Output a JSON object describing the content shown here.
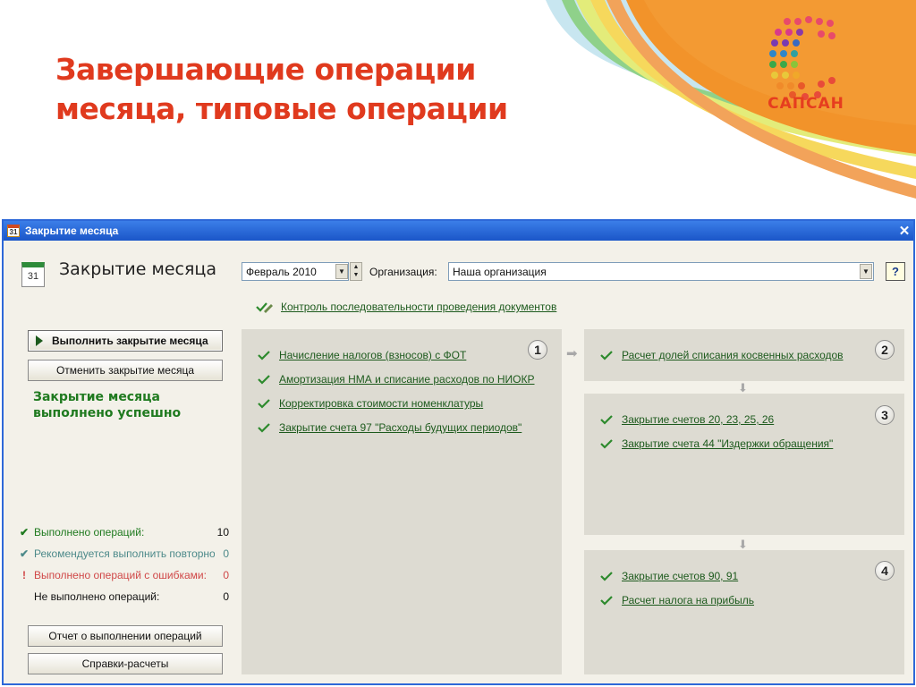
{
  "slide": {
    "title_line1": "Завершающие операции",
    "title_line2": "месяца, типовые операции",
    "logo_text": "САПСАН"
  },
  "window": {
    "title": "Закрытие месяца",
    "close_icon": "close-icon",
    "form_title": "Закрытие месяца",
    "period": "Февраль 2010",
    "org_label": "Организация:",
    "org_value": "Наша организация",
    "help_label": "?",
    "control_link": "Контроль последовательности проведения документов",
    "run_button": "Выполнить закрытие месяца",
    "cancel_button": "Отменить закрытие месяца",
    "status_line1": "Закрытие месяца",
    "status_line2": "выполнено успешно",
    "stats": [
      {
        "label": "Выполнено операций:",
        "value": "10",
        "color": "#1f7a1f",
        "icon": "✔"
      },
      {
        "label": "Рекомендуется выполнить повторно:",
        "value": "0",
        "color": "#4d8a8a",
        "icon": "✔"
      },
      {
        "label": "Выполнено операций с ошибками:",
        "value": "0",
        "color": "#d04848",
        "icon": "!"
      },
      {
        "label": "Не выполнено операций:",
        "value": "0",
        "color": "#111111",
        "icon": ""
      }
    ],
    "report_button": "Отчет о выполнении операций",
    "help_calc_button": "Справки-расчеты",
    "steps": [
      {
        "number": "1",
        "items": [
          "Начисление налогов (взносов) с ФОТ",
          "Амортизация НМА и списание расходов по НИОКР",
          "Корректировка стоимости номенклатуры",
          "Закрытие счета 97 \"Расходы будущих периодов\""
        ]
      },
      {
        "number": "2",
        "items": [
          "Расчет долей списания косвенных расходов"
        ]
      },
      {
        "number": "3",
        "items": [
          "Закрытие счетов 20, 23, 25, 26",
          "Закрытие счета 44 \"Издержки обращения\""
        ]
      },
      {
        "number": "4",
        "items": [
          "Закрытие счетов 90, 91",
          "Расчет налога на прибыль"
        ]
      }
    ]
  },
  "colors": {
    "title_red": "#e03a1e",
    "ok_green": "#1f7a1f",
    "titlebar_blue": "#2d68d8",
    "logo_orange": "#f2932a"
  }
}
